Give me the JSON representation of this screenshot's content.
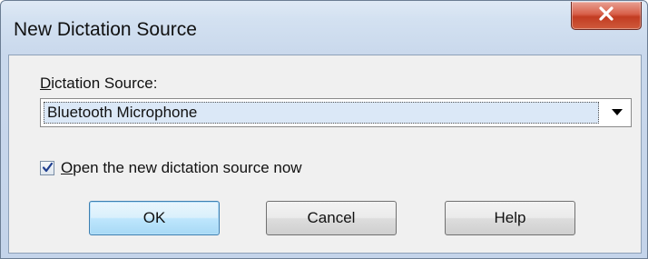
{
  "window": {
    "title": "New Dictation Source",
    "close_icon": "close-icon"
  },
  "form": {
    "source_label_mnemonic": "D",
    "source_label_rest": "ictation Source:",
    "source_value": "Bluetooth Microphone",
    "dropdown_icon": "chevron-down-icon",
    "open_now_checked": true,
    "open_now_label_mnemonic": "O",
    "open_now_label_rest": "pen the new dictation source now"
  },
  "buttons": {
    "ok": "OK",
    "cancel": "Cancel",
    "help": "Help"
  },
  "colors": {
    "close_button": "#c94a30",
    "default_button_border": "#3c7fb1",
    "selection_highlight": "#dbe8f7"
  }
}
